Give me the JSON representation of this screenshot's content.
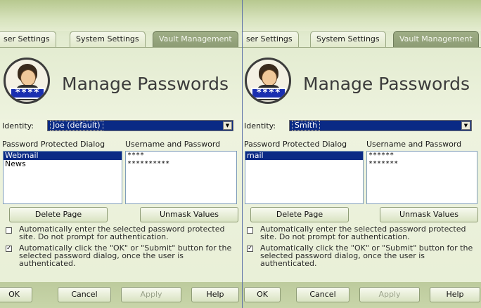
{
  "panes": [
    {
      "tabs": {
        "user": "ser Settings",
        "system": "System Settings",
        "vault": "Vault Management"
      },
      "title": "Manage Passwords",
      "avatar_badge": "****",
      "identity_label": "Identity:",
      "identity_value": "Joe (default)",
      "dialogs_header": "Password Protected Dialog",
      "credentials_header": "Username and Password",
      "dialogs": [
        "Webmail",
        "News"
      ],
      "credentials": [
        "****",
        "**********"
      ],
      "buttons": {
        "delete": "Delete Page",
        "unmask": "Unmask Values",
        "ok": "OK",
        "cancel": "Cancel",
        "apply": "Apply",
        "help": "Help"
      },
      "options": [
        {
          "text": "Automatically enter the selected password protected site. Do not prompt for authentication.",
          "checked": false
        },
        {
          "text": "Automatically click the \"OK\" or \"Submit\" button for the selected password dialog, once the user is authenticated.",
          "checked": true
        }
      ]
    },
    {
      "tabs": {
        "user": "ser Settings",
        "system": "System Settings",
        "vault": "Vault Management"
      },
      "title": "Manage Passwords",
      "avatar_badge": "****",
      "identity_label": "Identity:",
      "identity_value": "Smith",
      "dialogs_header": "Password Protected Dialog",
      "credentials_header": "Username and Password",
      "dialogs": [
        "mail"
      ],
      "credentials": [
        "******",
        "*******"
      ],
      "buttons": {
        "delete": "Delete Page",
        "unmask": "Unmask Values",
        "ok": "OK",
        "cancel": "Cancel",
        "apply": "Apply",
        "help": "Help"
      },
      "options": [
        {
          "text": "Automatically enter the selected password protected site. Do not prompt for authentication.",
          "checked": false
        },
        {
          "text": "Automatically click the \"OK\" or \"Submit\" button for the selected password dialog, once the user is authenticated.",
          "checked": true
        }
      ]
    }
  ],
  "colors": {
    "selection": "#0a2a85",
    "panel": "#e8efd6",
    "active_tab": "#8c9b74",
    "divider": "#5a6fa8"
  },
  "icons": {
    "avatar": "user-avatar-icon",
    "dropdown": "chevron-down-icon",
    "checkbox": "checkbox-icon"
  }
}
